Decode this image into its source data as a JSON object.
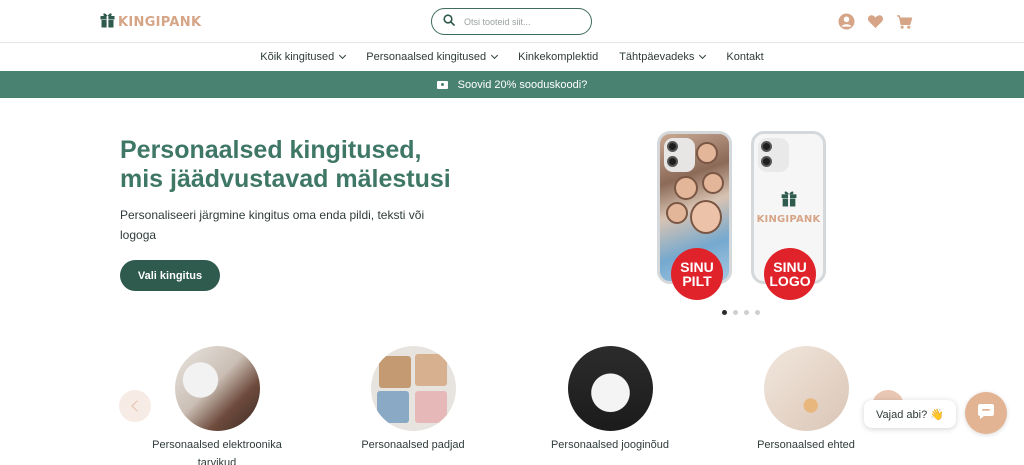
{
  "brand": {
    "name": "KINGIPANK",
    "color": "#d6a587"
  },
  "search": {
    "placeholder": "Otsi tooteid siit..."
  },
  "header_icons": [
    "account-icon",
    "heart-icon",
    "cart-icon"
  ],
  "nav": {
    "items": [
      {
        "label": "Kõik kingitused",
        "has_dropdown": true
      },
      {
        "label": "Personaalsed kingitused",
        "has_dropdown": true
      },
      {
        "label": "Kinkekomplektid",
        "has_dropdown": false
      },
      {
        "label": "Tähtpäevadeks",
        "has_dropdown": true
      },
      {
        "label": "Kontakt",
        "has_dropdown": false
      }
    ]
  },
  "promo": {
    "text": "Soovid 20% sooduskoodi?",
    "bg": "#4a8272"
  },
  "hero": {
    "title_line1": "Personaalsed kingitused,",
    "title_line2": "mis jäädvustavad mälestusi",
    "subtitle": "Personaliseeri järgmine kingitus oma enda pildi, teksti või logoga",
    "cta": "Vali kingitus",
    "badge1": [
      "SINU",
      "PILT"
    ],
    "badge2": [
      "SINU",
      "LOGO"
    ],
    "phone_logo": "KINGIPANK",
    "slides": 4,
    "active_slide": 1
  },
  "categories": [
    {
      "label": "Personaalsed elektroonika tarvikud"
    },
    {
      "label": "Personaalsed padjad"
    },
    {
      "label": "Personaalsed jooginõud"
    },
    {
      "label": "Personaalsed ehted"
    }
  ],
  "chat": {
    "bubble": "Vajad abi? 👋"
  },
  "colors": {
    "primary": "#3f7766",
    "dark": "#2f5a4e",
    "accent": "#d6a587",
    "badge": "#e0232a"
  }
}
